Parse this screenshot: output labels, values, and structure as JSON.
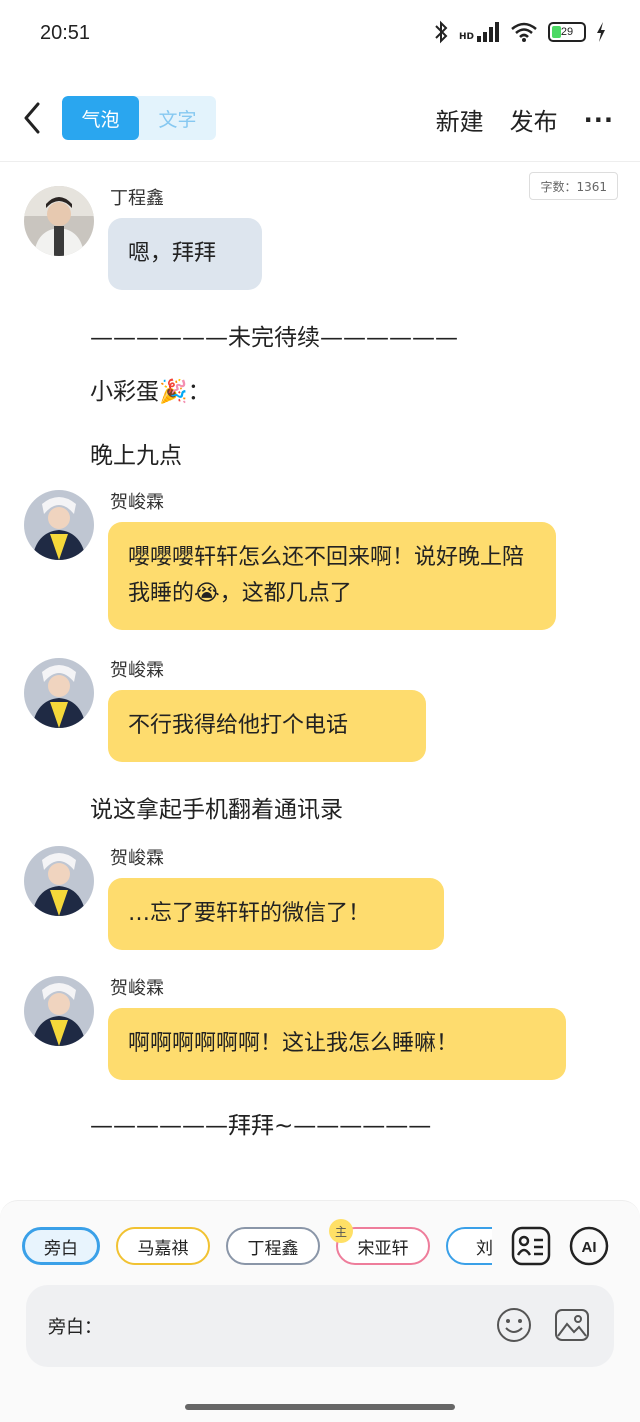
{
  "status": {
    "time": "20:51",
    "hd": "HD",
    "battery": "29",
    "battery_level": 0.29
  },
  "topbar": {
    "mode_bubble": "气泡",
    "mode_text": "文字",
    "new_label": "新建",
    "publish_label": "发布",
    "more_label": "···"
  },
  "wordcount": "字数：1361",
  "messages": [
    {
      "name": "丁程鑫",
      "text": "嗯，拜拜",
      "color": "gray"
    },
    {
      "name": "贺峻霖",
      "text": "嚶嚶嚶轩轩怎么还不回来啊！说好晚上陪我睡的😭，这都几点了",
      "color": "yellow"
    },
    {
      "name": "贺峻霖",
      "text": "不行我得给他打个电话",
      "color": "yellow"
    },
    {
      "name": "贺峻霖",
      "text": "…忘了要轩轩的微信了！",
      "color": "yellow"
    },
    {
      "name": "贺峻霖",
      "text": "啊啊啊啊啊啊！这让我怎么睡嘛！",
      "color": "yellow"
    }
  ],
  "narration": [
    "——————未完待续——————",
    "小彩蛋🎉：",
    "晚上九点",
    "说这拿起手机翻着通讯录",
    "——————拜拜~——————"
  ],
  "chips": [
    "旁白",
    "马嘉祺",
    "丁程鑫",
    "宋亚轩",
    "刘耀"
  ],
  "host_badge": "主",
  "input": {
    "label": "旁白：",
    "placeholder": ""
  },
  "colors": {
    "accent": "#2aa6ef",
    "bubble_yellow": "#fedc6e",
    "bubble_gray": "#dde5ee"
  }
}
